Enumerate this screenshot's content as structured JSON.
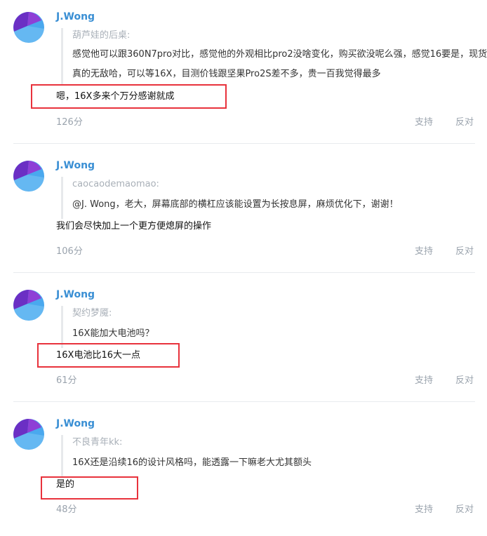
{
  "comments": [
    {
      "username": "J.Wong",
      "quote_author": "葫芦娃的后桌:",
      "quote_text": "感觉他可以跟360N7pro对比，感觉他的外观相比pro2没啥变化，购买欲没呢么强，感觉16要是，现货真的无敌哈，可以等16X，目测价钱跟坚果Pro2S差不多，贵一百我觉得最多",
      "reply": "嗯，16X多来个万分感谢就成",
      "score": "126分",
      "support": "支持",
      "oppose": "反对"
    },
    {
      "username": "J.Wong",
      "quote_author": "caocaodemaomao:",
      "quote_text": "@J. Wong，老大，屏幕底部的横杠应该能设置为长按息屏，麻烦优化下，谢谢！",
      "reply": "我们会尽快加上一个更方便熄屏的操作",
      "score": "106分",
      "support": "支持",
      "oppose": "反对"
    },
    {
      "username": "J.Wong",
      "quote_author": "契约梦魇:",
      "quote_text": "16X能加大电池吗？",
      "reply": "16X电池比16大一点",
      "score": "61分",
      "support": "支持",
      "oppose": "反对"
    },
    {
      "username": "J.Wong",
      "quote_author": "不良青年kk:",
      "quote_text": "16X还是沿续16的设计风格吗，能透露一下嘛老大尤其额头",
      "reply": "是的",
      "score": "48分",
      "support": "支持",
      "oppose": "反对"
    }
  ],
  "colors": {
    "username": "#3a8fd4",
    "highlight_box": "#e8323c",
    "muted_text": "#9aa3ad",
    "avatar_purple": "#6b2fc4",
    "avatar_blue": "#4aa8ee",
    "avatar_light_blue": "#7cc4f6"
  },
  "icons": {
    "avatar": "meizu-logo-avatar"
  }
}
